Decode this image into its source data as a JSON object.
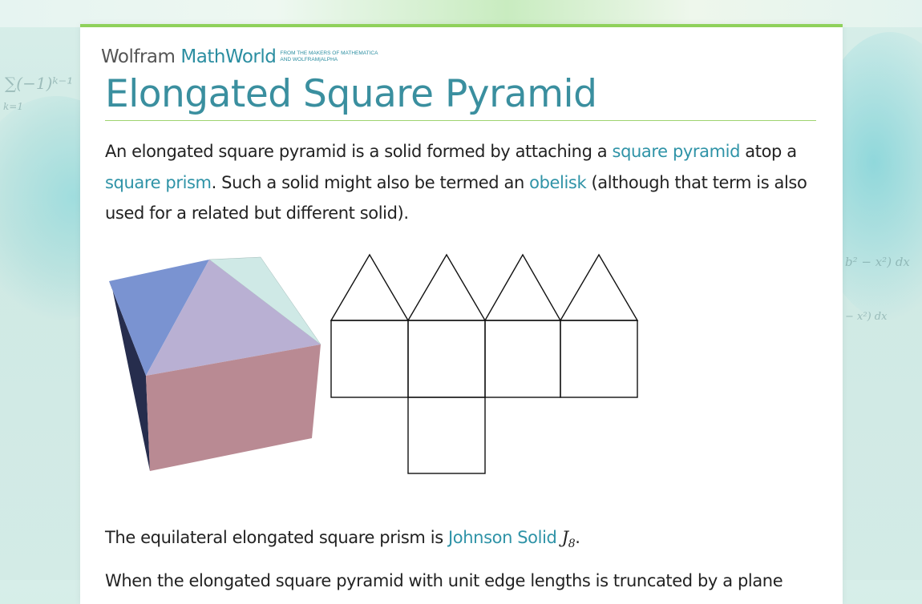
{
  "site": {
    "brand_wolfram": "Wolfram",
    "brand_mathworld": "MathWorld",
    "tagline_line1": "FROM THE MAKERS OF MATHEMATICA",
    "tagline_line2": "AND WOLFRAM|ALPHA"
  },
  "page": {
    "title": "Elongated Square Pyramid",
    "intro": {
      "part1": "An elongated square pyramid is a solid formed by attaching a ",
      "link1": "square pyramid",
      "part2": " atop a ",
      "link2": "square prism",
      "part3": ". Such a solid might also be termed an ",
      "link3": "obelisk",
      "part4": " (although that term is also used for a related but different solid)."
    },
    "second": {
      "part1": "The equilateral elongated square prism is ",
      "link1": "Johnson Solid",
      "math_symbol": "J",
      "math_subscript": "8",
      "part2": "."
    },
    "third_partial": "When the elongated square pyramid with unit edge lengths is truncated by a plane"
  },
  "figure": {
    "solid_colors": {
      "top_left_face": "#7a93d1",
      "front_triangle_face": "#b9b0d3",
      "back_right_face": "#cfe9e6",
      "front_square_face": "#b98a93",
      "left_side_face": "#262d4d"
    }
  },
  "background": {
    "formula_1": "∑(−1)ᵏ⁻¹",
    "formula_2": "k=1",
    "formula_3": "b² − x²) dx",
    "formula_4": "− x²) dx"
  }
}
